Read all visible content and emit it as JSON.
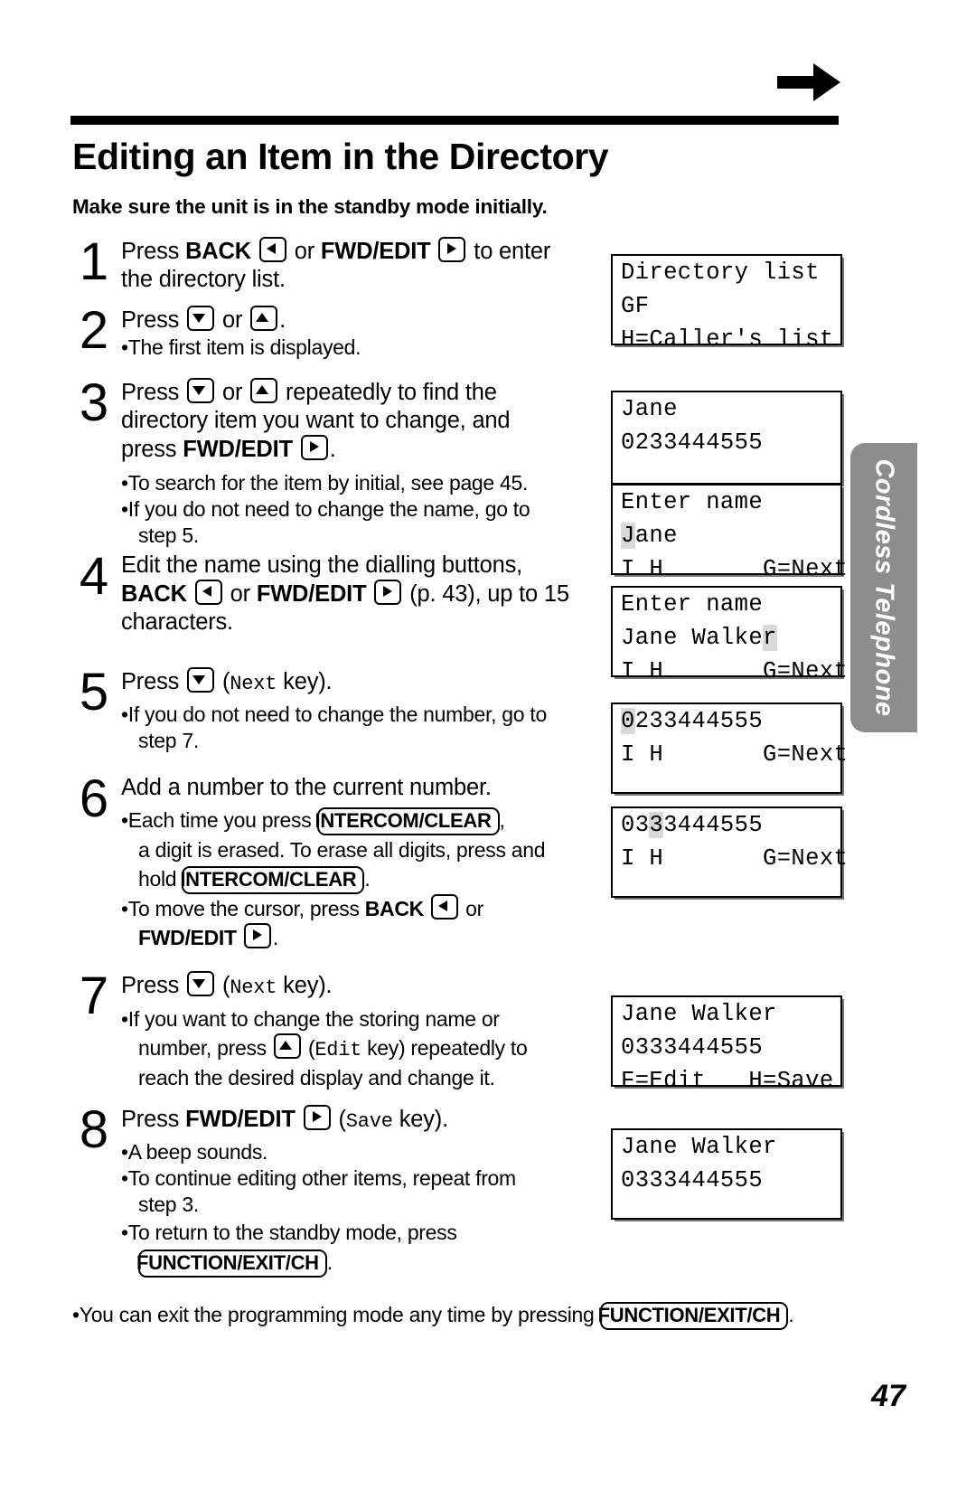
{
  "header": {
    "title": "Editing an Item in the Directory",
    "subtitle": "Make sure the unit is in the standby mode initially."
  },
  "side_tab": {
    "label": "Cordless Telephone"
  },
  "page_number": "47",
  "steps": [
    {
      "num": "1",
      "lines": [
        {
          "parts": [
            "Press ",
            "BACK",
            " ",
            "[left-key]",
            " or ",
            "FWD/EDIT",
            " ",
            "[right-key]",
            " to enter"
          ]
        },
        {
          "parts": [
            "the directory list."
          ]
        }
      ],
      "bullets": []
    },
    {
      "num": "2",
      "lines": [
        {
          "parts": [
            "Press ",
            "[down-key]",
            " or ",
            "[up-key]",
            "."
          ]
        }
      ],
      "bullets": [
        "The first item is displayed."
      ]
    },
    {
      "num": "3",
      "lines": [
        {
          "parts": [
            "Press ",
            "[down-key]",
            " or ",
            "[up-key]",
            " repeatedly to find the"
          ]
        },
        {
          "parts": [
            "directory item you want to change, and"
          ]
        },
        {
          "parts": [
            "press ",
            "FWD/EDIT",
            " ",
            "[right-key]",
            "."
          ]
        }
      ],
      "bullets": [
        "To search for the item by initial, see page 45.",
        "If you do not need to change the name, go to step 5."
      ]
    },
    {
      "num": "4",
      "lines": [
        {
          "parts": [
            "Edit the name using the dialling buttons,"
          ]
        },
        {
          "parts": [
            "BACK",
            " ",
            "[left-key]",
            " or ",
            "FWD/EDIT",
            " ",
            "[right-key]",
            " (p. 43), up to 15"
          ]
        },
        {
          "parts": [
            "characters."
          ]
        }
      ],
      "bullets": []
    },
    {
      "num": "5",
      "lines": [
        {
          "parts": [
            "Press ",
            "[down-key]",
            " (",
            "Next",
            " key)."
          ]
        }
      ],
      "bullets": [
        "If you do not need to change the number, go to step 7."
      ]
    },
    {
      "num": "6",
      "lines": [
        {
          "parts": [
            "Add a number to the current number."
          ]
        }
      ],
      "bullets": [
        "Each time you press INTERCOM/CLEAR, a digit is erased. To erase all digits, press and hold INTERCOM/CLEAR.",
        "To move the cursor, press BACK [left-key] or FWD/EDIT [right-key]."
      ]
    },
    {
      "num": "7",
      "lines": [
        {
          "parts": [
            "Press ",
            "[down-key]",
            " (",
            "Next",
            " key)."
          ]
        }
      ],
      "bullets": [
        "If you want to change the storing name or number, press [up-key] (Edit key) repeatedly to reach the desired display and change it."
      ]
    },
    {
      "num": "8",
      "lines": [
        {
          "parts": [
            "Press ",
            "FWD/EDIT",
            " ",
            "[right-key]",
            " (",
            "Save",
            " key)."
          ]
        }
      ],
      "bullets": [
        "A beep sounds.",
        "To continue editing other items, repeat from step 3.",
        "To return to the standby mode, press FUNCTION/EXIT/CH."
      ]
    }
  ],
  "step_text": {
    "s1_l1_a": "Press ",
    "s1_back": "BACK",
    "s1_or": " or ",
    "s1_fwd": "FWD/EDIT",
    "s1_l1_b": " to enter",
    "s1_l2": "the directory list.",
    "s2_press": "Press ",
    "s2_or": " or ",
    "s2_dot": ".",
    "s2_b1": "The first item is displayed.",
    "s3_press": "Press ",
    "s3_or": " or ",
    "s3_rep": " repeatedly to find the",
    "s3_l2": "directory item you want to change, and",
    "s3_l3_a": "press ",
    "s3_fwd": "FWD/EDIT",
    "s3_l3_b": ".",
    "s3_b1": "To search for the item by initial, see page 45.",
    "s3_b2a": "If you do not need to change the name, go to",
    "s3_b2b": "step 5.",
    "s4_l1": "Edit the name using the dialling buttons,",
    "s4_back": "BACK",
    "s4_or": " or ",
    "s4_fwd": "FWD/EDIT",
    "s4_l2_end": " (p. 43), up to 15",
    "s4_l3": "characters.",
    "s5_press": "Press ",
    "s5_paren_open": " (",
    "s5_next": "Next",
    "s5_key": " key).",
    "s5_b1a": "If you do not need to change the number, go to",
    "s5_b1b": "step 7.",
    "s6_l1": "Add a number to the current number.",
    "s6_b1a": "Each time you press ",
    "s6_intercom": "INTERCOM/CLEAR",
    "s6_b1b": ",",
    "s6_b1c": "a digit is erased. To erase all digits, press and",
    "s6_b1d": "hold ",
    "s6_b1e": ".",
    "s6_b2a": "To move the cursor, press ",
    "s6_back": "BACK",
    "s6_b2b": " or",
    "s6_fwd": "FWD/EDIT",
    "s6_b2c": ".",
    "s7_press": "Press ",
    "s7_paren_open": " (",
    "s7_next": "Next",
    "s7_key": " key).",
    "s7_b1a": "If you want to change the storing name or",
    "s7_b1b": "number, press ",
    "s7_edit": "Edit",
    "s7_b1c": " key) repeatedly to",
    "s7_b1d": "reach the desired display and change it.",
    "s8_press": "Press ",
    "s8_fwd": "FWD/EDIT",
    "s8_paren_open": " (",
    "s8_save": "Save",
    "s8_key": " key).",
    "s8_b1": "A beep sounds.",
    "s8_b2a": "To continue editing other items, repeat from",
    "s8_b2b": "step 3.",
    "s8_b3a": "To return to the standby mode, press",
    "s8_function": "FUNCTION/EXIT/CH",
    "s8_b3b": "."
  },
  "footnote": {
    "text_a": "You can exit the programming mode any time by pressing ",
    "key": "FUNCTION/EXIT/CH",
    "text_b": "."
  },
  "displays": [
    {
      "id": "display-1",
      "rows": [
        {
          "text": "Directory list"
        },
        {
          "text": "GF"
        },
        {
          "text": "H=Caller's list"
        }
      ]
    },
    {
      "id": "display-2",
      "rows": [
        {
          "text": "Jane"
        },
        {
          "text": "0233444555"
        },
        {
          "text": ""
        }
      ]
    },
    {
      "id": "display-3",
      "rows": [
        {
          "text": "Enter name"
        },
        {
          "pre": "",
          "cursor": "J",
          "post": "ane"
        },
        {
          "text": "I H       G=Next"
        }
      ]
    },
    {
      "id": "display-4",
      "rows": [
        {
          "text": "Enter name"
        },
        {
          "pre": "Jane Walke",
          "cursor": "r",
          "post": ""
        },
        {
          "text": "I H       G=Next"
        }
      ]
    },
    {
      "id": "display-5",
      "rows": [
        {
          "pre": "",
          "cursor": "0",
          "post": "233444555"
        },
        {
          "text": ""
        },
        {
          "text": "I H       G=Next"
        }
      ]
    },
    {
      "id": "display-6",
      "rows": [
        {
          "pre": "03",
          "cursor": "3",
          "post": "3444555"
        },
        {
          "text": ""
        },
        {
          "text": "I H       G=Next"
        }
      ]
    },
    {
      "id": "display-7",
      "rows": [
        {
          "text": "Jane Walker"
        },
        {
          "text": "0333444555"
        },
        {
          "text": "F=Edit   H=Save"
        }
      ]
    },
    {
      "id": "display-8",
      "rows": [
        {
          "text": "Jane Walker"
        },
        {
          "text": "0333444555"
        },
        {
          "text": ""
        }
      ]
    }
  ]
}
